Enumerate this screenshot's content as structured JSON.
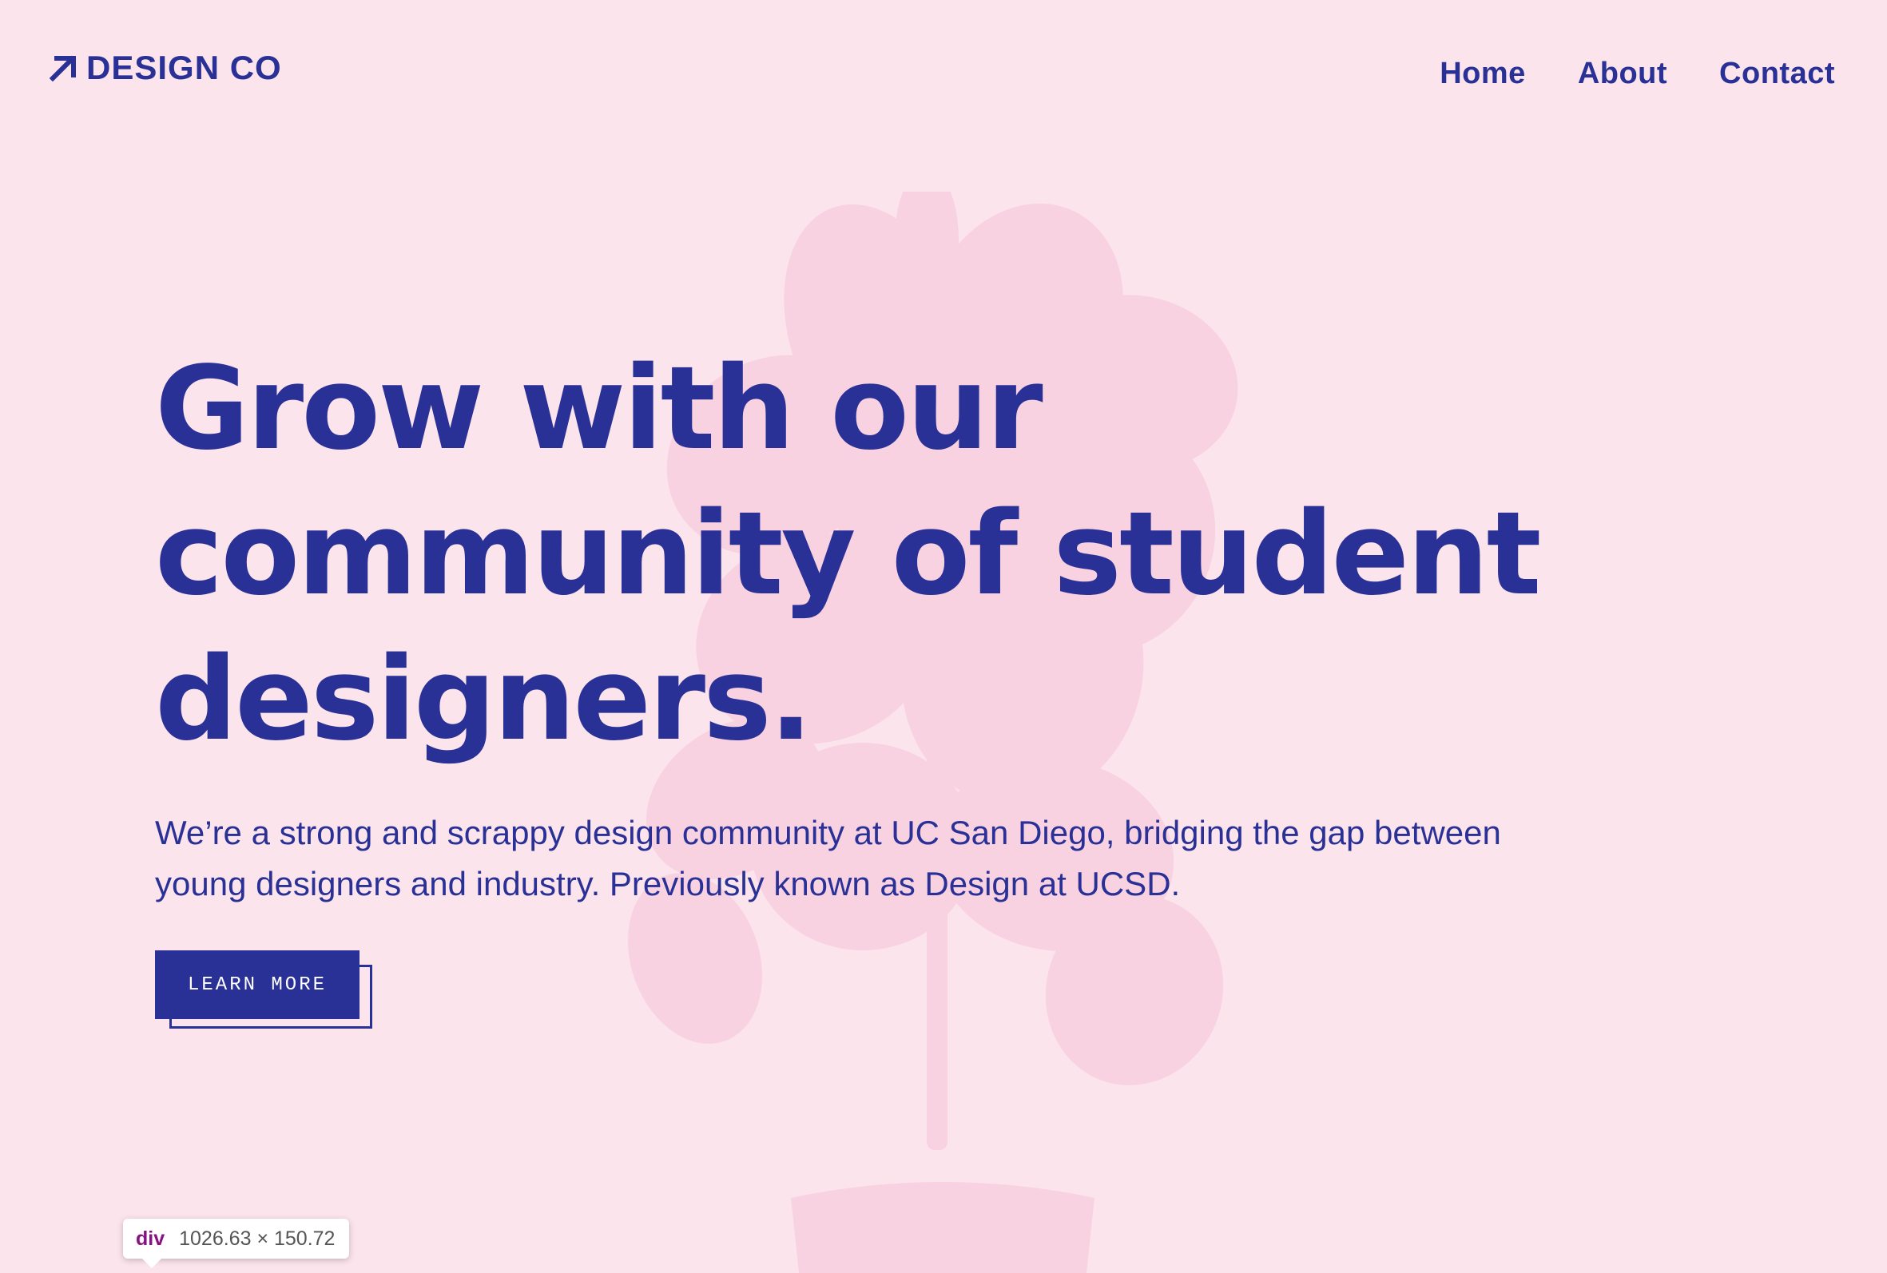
{
  "colors": {
    "background": "#fce4ec",
    "accent": "#2a3196",
    "plant": "#f8cfe0"
  },
  "header": {
    "logo_icon": "arrow-up-right-icon",
    "logo_text": "DESIGN CO",
    "nav": [
      {
        "label": "Home"
      },
      {
        "label": "About"
      },
      {
        "label": "Contact"
      }
    ]
  },
  "hero": {
    "title": "Grow with our community of student designers.",
    "description": "We’re a strong and scrappy design community at UC San Diego, bridging the gap between young designers and industry. Previously known as Design at UCSD.",
    "cta_label": "LEARN MORE"
  },
  "background_image": {
    "icon": "potted-plant-image"
  },
  "inspect_tooltip": {
    "tag": "div",
    "size": "1026.63 × 150.72"
  }
}
